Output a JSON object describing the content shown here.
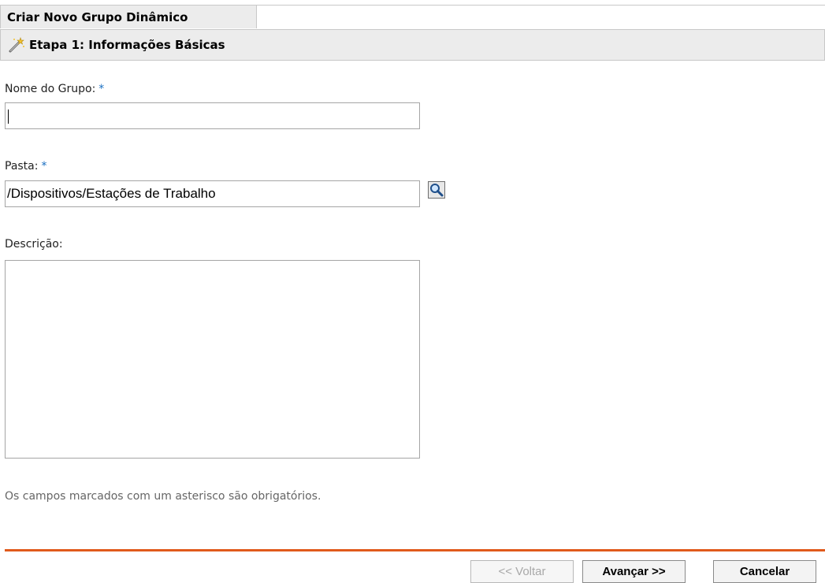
{
  "header": {
    "title": "Criar Novo Grupo Dinâmico",
    "step_title": "Etapa 1: Informações Básicas",
    "step_icon": "wand-icon"
  },
  "form": {
    "group_name": {
      "label": "Nome do Grupo:",
      "required_marker": "*",
      "value": ""
    },
    "folder": {
      "label": "Pasta:",
      "required_marker": "*",
      "value": "/Dispositivos/Estações de Trabalho",
      "browse_icon": "magnifier-icon"
    },
    "description": {
      "label": "Descrição:",
      "value": ""
    }
  },
  "note": "Os campos marcados com um asterisco são obrigatórios.",
  "buttons": {
    "back": "<< Voltar",
    "next": "Avançar >>",
    "cancel": "Cancelar"
  },
  "colors": {
    "required_marker": "#1a6fc2",
    "divider": "#e05a1c",
    "header_bg": "#ececec"
  }
}
